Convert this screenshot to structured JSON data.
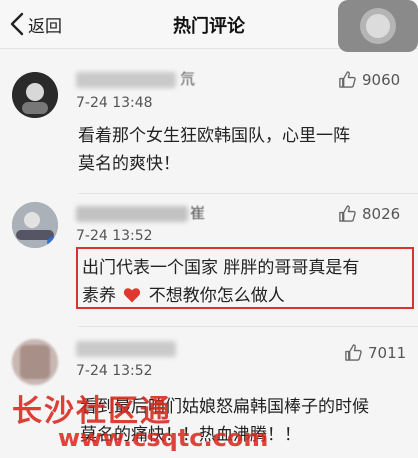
{
  "header": {
    "back_label": "返回",
    "title": "热门评论"
  },
  "comments": [
    {
      "name_tail": "氘",
      "time": "7-24 13:48",
      "likes": "9060",
      "lines": [
        "看着那个女生狂欧韩国队，心里一阵",
        "莫名的爽快！"
      ]
    },
    {
      "name_tail": "崔",
      "time": "7-24 13:52",
      "likes": "8026",
      "line1": "出门代表一个国家 胖胖的哥哥真是有",
      "line2_a": "素养 ",
      "line2_b": " 不想教你怎么做人"
    },
    {
      "time": "7-24 13:52",
      "likes": "7011",
      "lines": [
        "看到最后咱们姑娘怒扁韩国棒子的时候",
        "莫名的痛快！！热血沸腾！！"
      ]
    }
  ],
  "watermark": {
    "text": "长沙社区通",
    "url": "www.csqtc.com"
  },
  "colors": {
    "highlight_border": "#d9342b",
    "heart": "#e0382e",
    "watermark": "#d8261c"
  }
}
